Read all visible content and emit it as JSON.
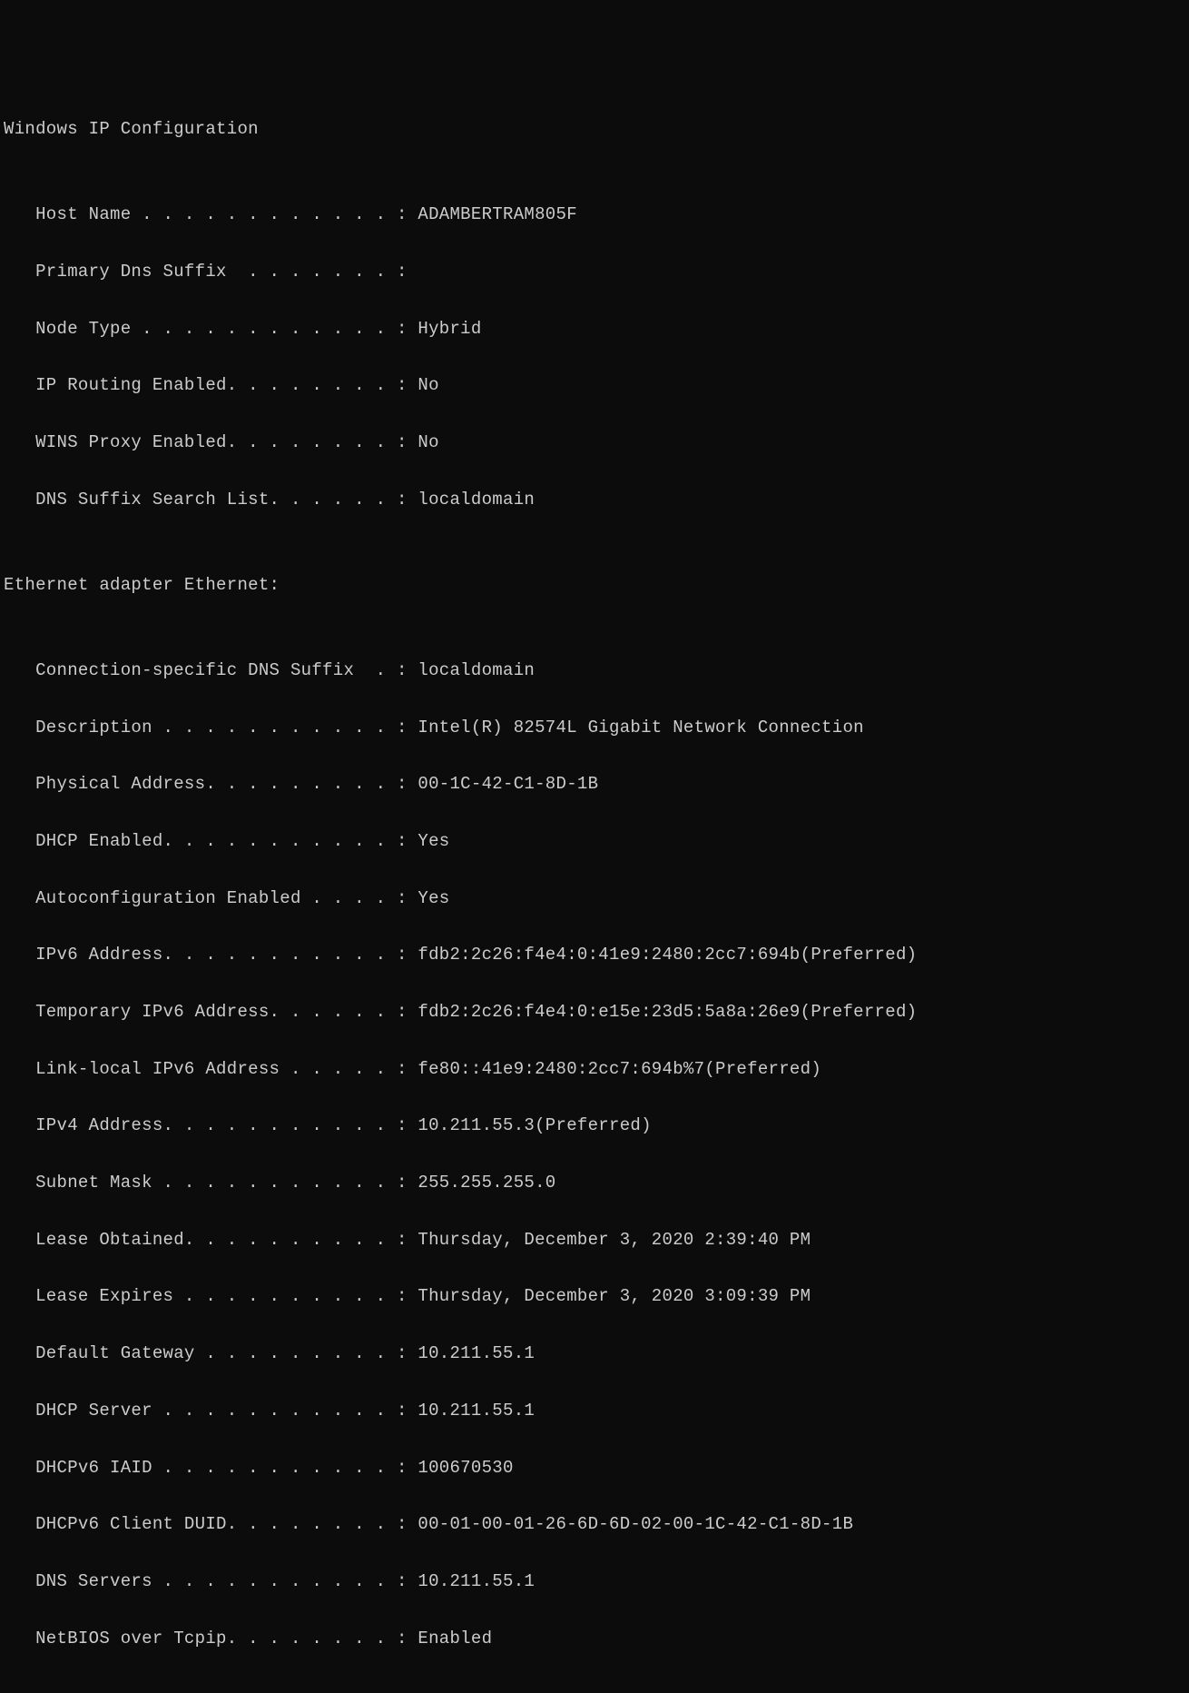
{
  "header": "Windows IP Configuration",
  "blank": "",
  "ipconfig": {
    "host_name_line": "   Host Name . . . . . . . . . . . . : ADAMBERTRAM805F",
    "primary_dns_suffix_line": "   Primary Dns Suffix  . . . . . . . :",
    "node_type_line": "   Node Type . . . . . . . . . . . . : Hybrid",
    "ip_routing_line": "   IP Routing Enabled. . . . . . . . : No",
    "wins_proxy_line": "   WINS Proxy Enabled. . . . . . . . : No",
    "dns_suffix_search_line": "   DNS Suffix Search List. . . . . . : localdomain"
  },
  "adapter_header": "Ethernet adapter Ethernet:",
  "adapter": {
    "conn_dns_suffix_line": "   Connection-specific DNS Suffix  . : localdomain",
    "description_line": "   Description . . . . . . . . . . . : Intel(R) 82574L Gigabit Network Connection",
    "physical_address_line": "   Physical Address. . . . . . . . . : 00-1C-42-C1-8D-1B",
    "dhcp_enabled_line": "   DHCP Enabled. . . . . . . . . . . : Yes",
    "autoconfig_line": "   Autoconfiguration Enabled . . . . : Yes",
    "ipv6_address_line": "   IPv6 Address. . . . . . . . . . . : fdb2:2c26:f4e4:0:41e9:2480:2cc7:694b(Preferred)",
    "temp_ipv6_line": "   Temporary IPv6 Address. . . . . . : fdb2:2c26:f4e4:0:e15e:23d5:5a8a:26e9(Preferred)",
    "link_local_ipv6_line": "   Link-local IPv6 Address . . . . . : fe80::41e9:2480:2cc7:694b%7(Preferred)",
    "ipv4_address_line": "   IPv4 Address. . . . . . . . . . . : 10.211.55.3(Preferred)",
    "subnet_mask_line": "   Subnet Mask . . . . . . . . . . . : 255.255.255.0",
    "lease_obtained_line": "   Lease Obtained. . . . . . . . . . : Thursday, December 3, 2020 2:39:40 PM",
    "lease_expires_line": "   Lease Expires . . . . . . . . . . : Thursday, December 3, 2020 3:09:39 PM",
    "default_gateway_line": "   Default Gateway . . . . . . . . . : 10.211.55.1",
    "dhcp_server_line": "   DHCP Server . . . . . . . . . . . : 10.211.55.1",
    "dhcpv6_iaid_line": "   DHCPv6 IAID . . . . . . . . . . . : 100670530",
    "dhcpv6_client_duid_line": "   DHCPv6 Client DUID. . . . . . . . : 00-01-00-01-26-6D-6D-02-00-1C-42-C1-8D-1B",
    "dns_servers_line": "   DNS Servers . . . . . . . . . . . : 10.211.55.1",
    "netbios_line": "   NetBIOS over Tcpip. . . . . . . . : Enabled"
  }
}
